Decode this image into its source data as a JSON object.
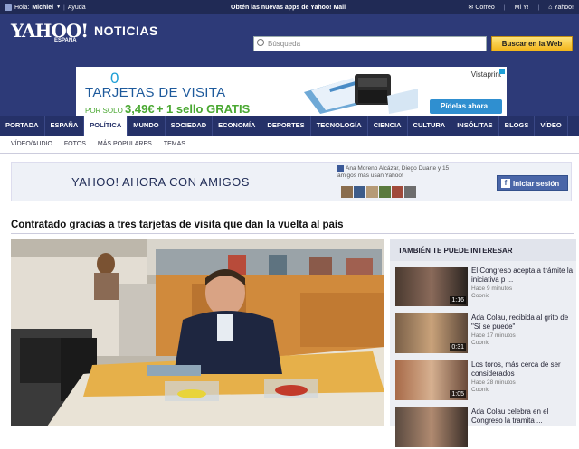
{
  "topbar": {
    "greeting": "Hola:",
    "user": "Michiel",
    "help": "Ayuda",
    "promo": "Obtén las nuevas apps de Yahoo! Mail",
    "mail": "Correo",
    "myy": "Mi Y!",
    "home": "Yahoo!"
  },
  "header": {
    "logo": "YAHOO!",
    "logo_sub": "ESPAÑA",
    "section": "NOTICIAS",
    "search_placeholder": "Búsqueda",
    "search_button": "Buscar en la Web"
  },
  "ad": {
    "number": "0",
    "title": "TARJETAS DE VISITA",
    "offer_prefix": "POR SOLO",
    "offer_price": "3,49€",
    "offer_rest": "+ 1 sello GRATIS",
    "brand": "Vistaprint",
    "button": "Pídelas ahora"
  },
  "nav": {
    "items": [
      "PORTADA",
      "ESPAÑA",
      "POLÍTICA",
      "MUNDO",
      "SOCIEDAD",
      "ECONOMÍA",
      "DEPORTES",
      "TECNOLOGÍA",
      "CIENCIA",
      "CULTURA",
      "INSÓLITAS",
      "BLOGS",
      "VÍDEO"
    ],
    "active": "POLÍTICA"
  },
  "subnav": [
    "VÍDEO/AUDIO",
    "FOTOS",
    "MÁS POPULARES",
    "TEMAS"
  ],
  "banner": {
    "title": "YAHOO! AHORA CON AMIGOS",
    "friends_text": "Ana Moreno Alcázar, Diego Duarte y 15 amigos más usan Yahoo!",
    "button": "Iniciar sesión"
  },
  "article": {
    "headline": "Contratado gracias a tres tarjetas de visita que dan la vuelta al país"
  },
  "sidebar": {
    "title": "TAMBIÉN TE PUEDE INTERESAR",
    "items": [
      {
        "title": "El Congreso acepta a trámite la iniciativa p ...",
        "time": "Hace 9 minutos",
        "source": "Coonic",
        "duration": "1:16"
      },
      {
        "title": "Ada Colau, recibida al grito de \"Sí se puede\"",
        "time": "Hace 17 minutos",
        "source": "Coonic",
        "duration": "0:31"
      },
      {
        "title": "Los toros, más cerca de ser considerados",
        "time": "Hace 28 minutos",
        "source": "Coonic",
        "duration": "1:05"
      },
      {
        "title": "Ada Colau celebra en el Congreso la tramita ...",
        "time": "",
        "source": "",
        "duration": ""
      }
    ]
  },
  "colors": {
    "header_bg": "#2d3a78",
    "nav_bg": "#253168",
    "accent_yellow": "#f3b51a"
  }
}
